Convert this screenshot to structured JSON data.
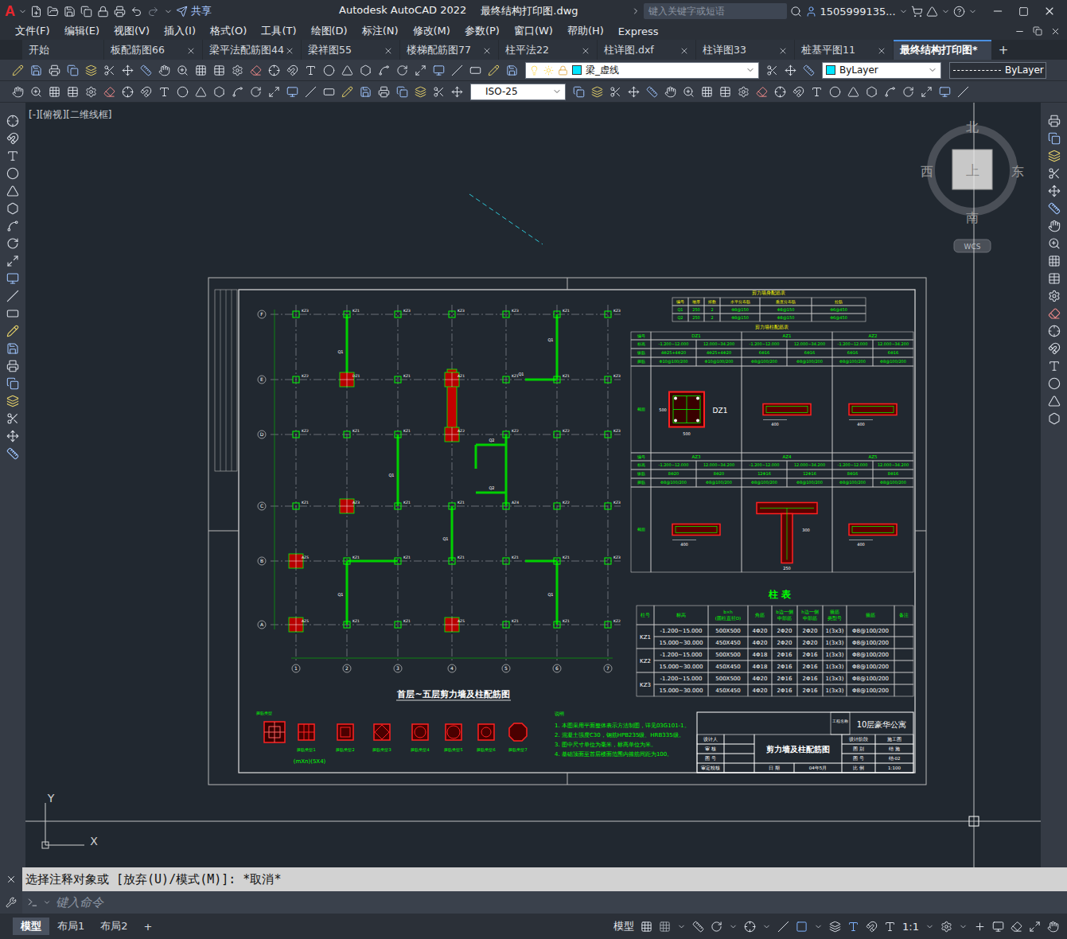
{
  "window": {
    "logo": "A",
    "title": "Autodesk AutoCAD 2022",
    "file": "最终结构打印图.dwg",
    "share": "共享",
    "search_placeholder": "键入关键字或短语",
    "user": "1505999135..."
  },
  "menu": [
    "文件(F)",
    "编辑(E)",
    "视图(V)",
    "插入(I)",
    "格式(O)",
    "工具(T)",
    "绘图(D)",
    "标注(N)",
    "修改(M)",
    "参数(P)",
    "窗口(W)",
    "帮助(H)",
    "Express"
  ],
  "file_tabs": [
    {
      "label": "开始",
      "selected": false,
      "closable": false
    },
    {
      "label": "板配筋图66",
      "selected": false,
      "closable": true
    },
    {
      "label": "梁平法配筋图44",
      "selected": false,
      "closable": true
    },
    {
      "label": "梁祥图55",
      "selected": false,
      "closable": true
    },
    {
      "label": "楼梯配筋图77",
      "selected": false,
      "closable": true
    },
    {
      "label": "柱平法22",
      "selected": false,
      "closable": true
    },
    {
      "label": "柱详图.dxf",
      "selected": false,
      "closable": true
    },
    {
      "label": "柱详图33",
      "selected": false,
      "closable": true
    },
    {
      "label": "桩基平图11",
      "selected": false,
      "closable": true
    },
    {
      "label": "最终结构打印图*",
      "selected": true,
      "closable": false
    }
  ],
  "new_tab": "+",
  "layer": {
    "name": "梁_虚线",
    "color": "#00e5ff"
  },
  "color_control": {
    "label": "ByLayer",
    "color": "#00e5ff"
  },
  "linetype": {
    "label": "ByLayer"
  },
  "dim_style": "ISO-25",
  "viewport_label": "[-][俯视][二维线框]",
  "viewcube": {
    "north": "北",
    "south": "南",
    "east": "东",
    "west": "西",
    "top": "上",
    "wcs": "WCS"
  },
  "ucs": {
    "x": "X",
    "y": "Y"
  },
  "command": {
    "history": "选择注释对象或 [放弃(U)/模式(M)]: *取消*",
    "placeholder": "键入命令"
  },
  "layout_tabs": [
    {
      "label": "模型",
      "selected": true
    },
    {
      "label": "布局1",
      "selected": false
    },
    {
      "label": "布局2",
      "selected": false
    }
  ],
  "add_layout": "+",
  "status": {
    "space": "模型",
    "scale": "1:1"
  },
  "drawing": {
    "plan": {
      "title": "首层~五层剪力墙及柱配筋图",
      "axes_rows": [
        "F",
        "E",
        "D",
        "C",
        "B",
        "A"
      ],
      "axes_cols": [
        "1",
        "2",
        "3",
        "4",
        "5",
        "6",
        "7"
      ],
      "columns": [
        [
          {
            "tag": "KZ3",
            "kind": "frame"
          },
          {
            "tag": "KZ1",
            "kind": "frame"
          },
          {
            "tag": "KZ3",
            "kind": "frame"
          },
          {
            "tag": "KZ3",
            "kind": "frame"
          },
          {
            "tag": "KZ3",
            "kind": "frame"
          },
          {
            "tag": "KZ1",
            "kind": "frame"
          },
          {
            "tag": "KZ3",
            "kind": "frame"
          }
        ],
        [
          {
            "tag": "KZ2",
            "kind": "frame"
          },
          {
            "tag": "DZ1",
            "kind": "edge"
          },
          {
            "tag": "KZ1",
            "kind": "frame"
          },
          {
            "tag": "AZ1",
            "kind": "edge"
          },
          {
            "tag": "KZ1",
            "kind": "frame"
          },
          {
            "tag": "KZ1",
            "kind": "frame"
          },
          {
            "tag": "KZ3",
            "kind": "frame"
          }
        ],
        [
          {
            "tag": "KZ2",
            "kind": "frame"
          },
          {
            "tag": "KZ1",
            "kind": "frame"
          },
          {
            "tag": "KZ1",
            "kind": "frame"
          },
          {
            "tag": "AZ2",
            "kind": "edge"
          },
          {
            "tag": "KZ2",
            "kind": "frame"
          },
          {
            "tag": "KZ2",
            "kind": "frame"
          },
          {
            "tag": "KZ3",
            "kind": "frame"
          }
        ],
        [
          {
            "tag": "KZ1",
            "kind": "frame"
          },
          {
            "tag": "AZ3",
            "kind": "edge"
          },
          {
            "tag": "KZ1",
            "kind": "frame"
          },
          {
            "tag": "KZ1",
            "kind": "frame"
          },
          {
            "tag": "AZ4",
            "kind": "frame"
          },
          {
            "tag": "KZ2",
            "kind": "frame"
          },
          {
            "tag": "KZ3",
            "kind": "frame"
          }
        ],
        [
          {
            "tag": "AZ5",
            "kind": "edge"
          },
          {
            "tag": "KZ1",
            "kind": "frame"
          },
          {
            "tag": "KZ1",
            "kind": "frame"
          },
          {
            "tag": "KZ1",
            "kind": "frame"
          },
          {
            "tag": "KZ1",
            "kind": "frame"
          },
          {
            "tag": "KZ1",
            "kind": "frame"
          },
          {
            "tag": "KZ3",
            "kind": "frame"
          }
        ],
        [
          {
            "tag": "AZ5",
            "kind": "edge"
          },
          {
            "tag": "KZ1",
            "kind": "frame"
          },
          {
            "tag": "KZ1",
            "kind": "frame"
          },
          {
            "tag": "AZ5",
            "kind": "edge"
          },
          {
            "tag": "KZ1",
            "kind": "frame"
          },
          {
            "tag": "KZ1",
            "kind": "frame"
          },
          {
            "tag": "KZ2",
            "kind": "frame"
          }
        ]
      ],
      "wall_labels": [
        "Q1",
        "Q1",
        "Q1",
        "Q1",
        "Q1",
        "Q1",
        "Q1",
        "Q2",
        "Q2"
      ]
    },
    "wall_table": {
      "title": "剪力墙身配筋表",
      "header": [
        "编号",
        "墙厚",
        "排数",
        "水平分布筋",
        "垂直分布筋",
        "拉筋"
      ],
      "rows": [
        [
          "Q1",
          "250",
          "2",
          "Φ8@150",
          "Φ8@150",
          "Φ6@450"
        ],
        [
          "Q2",
          "250",
          "2",
          "Φ8@150",
          "Φ8@150",
          "Φ6@450"
        ]
      ]
    },
    "wall_column_table": {
      "title": "剪力墙柱配筋表",
      "row_labels": [
        "编号",
        "标高",
        "纵筋",
        "箍筋",
        "截面"
      ],
      "bands": [
        [
          {
            "name": "DZ1",
            "kind": "square",
            "levels": [
              "-1.200~12.000",
              "12.000~34.200"
            ],
            "bars": [
              "4Φ25+4Φ20",
              "4Φ25+4Φ20"
            ],
            "stirrups": [
              "Φ10@100/200",
              "Φ10@100/200"
            ],
            "dims": [
              "500",
              "500"
            ]
          },
          {
            "name": "AZ1",
            "kind": "rect",
            "levels": [
              "-1.200~12.000",
              "12.000~34.200"
            ],
            "bars": [
              "6Φ16",
              "6Φ16"
            ],
            "stirrups": [
              "Φ8@100/200",
              "Φ8@100/200"
            ],
            "dims": [
              "400"
            ]
          },
          {
            "name": "AZ2",
            "kind": "rect",
            "levels": [
              "-1.200~12.000",
              "12.000~34.200"
            ],
            "bars": [
              "6Φ16",
              "6Φ16"
            ],
            "stirrups": [
              "Φ8@100/200",
              "Φ8@100/200"
            ],
            "dims": [
              "400"
            ]
          }
        ],
        [
          {
            "name": "AZ3",
            "kind": "rect",
            "levels": [
              "-1.200~12.000",
              "12.000~34.200"
            ],
            "bars": [
              "8Φ20",
              "8Φ20"
            ],
            "stirrups": [
              "Φ8@100/200",
              "Φ8@100/200"
            ],
            "dims": [
              "400"
            ]
          },
          {
            "name": "AZ4",
            "kind": "tee",
            "levels": [
              "-1.200~12.000",
              "12.000~34.200"
            ],
            "bars": [
              "12Φ16",
              "12Φ16"
            ],
            "stirrups": [
              "Φ8@100/200",
              "Φ8@100/200"
            ],
            "dims": [
              "300",
              "250"
            ]
          },
          {
            "name": "AZ5",
            "kind": "rect",
            "levels": [
              "-1.200~12.000",
              "12.000~34.200"
            ],
            "bars": [
              "8Φ16",
              "8Φ16"
            ],
            "stirrups": [
              "Φ8@100/200",
              "Φ8@100/200"
            ],
            "dims": [
              "400"
            ]
          }
        ]
      ]
    },
    "column_table": {
      "title": "柱 表",
      "header": [
        {
          "lines": [
            "柱号"
          ]
        },
        {
          "lines": [
            "标高"
          ]
        },
        {
          "lines": [
            "b×h",
            "(圆柱直径D)"
          ]
        },
        {
          "lines": [
            "角筋"
          ]
        },
        {
          "lines": [
            "b边一侧",
            "中部筋"
          ]
        },
        {
          "lines": [
            "h边一侧",
            "中部筋"
          ]
        },
        {
          "lines": [
            "箍筋",
            "类型号"
          ]
        },
        {
          "lines": [
            "箍筋"
          ]
        },
        {
          "lines": [
            "备注"
          ]
        }
      ],
      "groups": [
        {
          "name": "KZ1",
          "rows": [
            [
              "-1.200~15.000",
              "500X500",
              "4Φ20",
              "2Φ20",
              "2Φ20",
              "1(3x3)",
              "Φ8@100/200"
            ],
            [
              "15.000~30.000",
              "450X450",
              "4Φ20",
              "2Φ20",
              "2Φ20",
              "1(3x3)",
              "Φ8@100/200"
            ]
          ]
        },
        {
          "name": "KZ2",
          "rows": [
            [
              "-1.200~15.000",
              "500X500",
              "4Φ18",
              "2Φ16",
              "2Φ16",
              "1(3x3)",
              "Φ8@100/200"
            ],
            [
              "15.000~30.000",
              "450X450",
              "4Φ18",
              "2Φ16",
              "2Φ16",
              "1(3x3)",
              "Φ8@100/200"
            ]
          ]
        },
        {
          "name": "KZ3",
          "rows": [
            [
              "-1.200~15.000",
              "500X500",
              "4Φ20",
              "2Φ16",
              "2Φ16",
              "1(3x3)",
              "Φ8@100/200"
            ],
            [
              "15.000~30.000",
              "450X450",
              "4Φ20",
              "2Φ16",
              "2Φ16",
              "1(3x3)",
              "Φ8@100/200"
            ]
          ]
        }
      ]
    },
    "notes": {
      "title": "说明",
      "lines": [
        "1. 本图采用平面整体表示方法制图，详见03G101-1。",
        "2. 混凝土强度C30，钢筋HPB235级、HRB335级。",
        "3. 图中尺寸单位为毫米，标高单位为米。",
        "4. 基础顶面至首层楼面范围内箍筋间距为100。"
      ]
    },
    "stirrups": {
      "title": "箍筋类型",
      "types": [
        {
          "label": "箍筋类型1",
          "sub": "(mXn)(5X4)"
        },
        {
          "label": "箍筋类型2"
        },
        {
          "label": "箍筋类型3"
        },
        {
          "label": "箍筋类型4"
        },
        {
          "label": "箍筋类型5"
        },
        {
          "label": "箍筋类型6"
        },
        {
          "label": "箍筋类型7"
        }
      ]
    },
    "title_block": {
      "project_label": "工程名称",
      "project": "10层豪华公寓",
      "drawing_name": "剪力墙及柱配筋图",
      "left_labels": [
        "设计人",
        "审 核",
        "图 号",
        "审定校核"
      ],
      "right": [
        [
          "设计阶段",
          "施工图"
        ],
        [
          "图 别",
          "结 施"
        ],
        [
          "图 号",
          "结-02"
        ],
        [
          "比 例",
          "1:100"
        ]
      ],
      "date_label": "日 期",
      "date": "04年5月"
    }
  }
}
